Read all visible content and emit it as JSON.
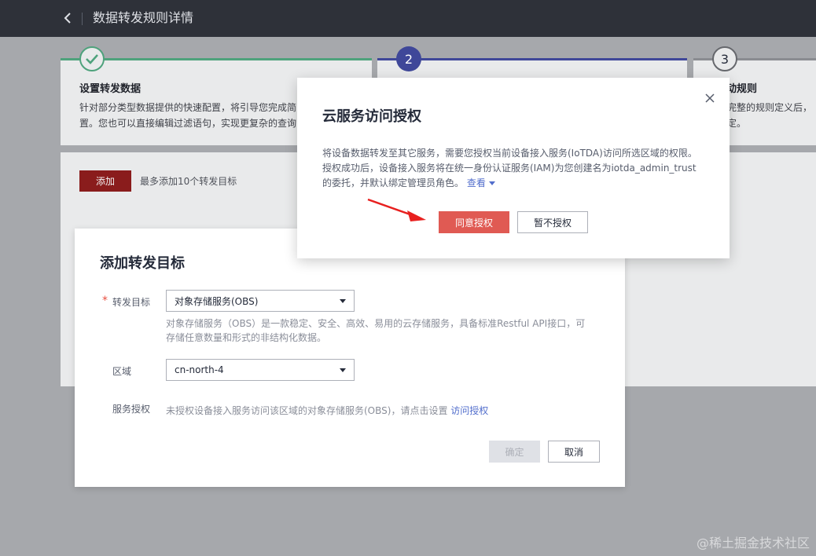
{
  "header": {
    "title": "数据转发规则详情",
    "back_icon": "chevron-left-icon"
  },
  "steps": [
    {
      "number": "",
      "state": "done",
      "title": "设置转发数据",
      "desc": "针对部分类型数据提供的快速配置，将引导您完成简置。您也可以直接编辑过滤语句，实现更复杂的查询"
    },
    {
      "number": "2",
      "state": "active",
      "title": "",
      "desc": ""
    },
    {
      "number": "3",
      "state": "pending",
      "title": "动规则",
      "desc": "完整的规则定义后，定。"
    }
  ],
  "list": {
    "add_label": "添加",
    "add_hint": "最多添加10个转发目标"
  },
  "add_dialog": {
    "title": "添加转发目标",
    "target_label": "转发目标",
    "required_mark": "*",
    "target_value": "对象存储服务(OBS)",
    "target_help": "对象存储服务（OBS）是一款稳定、安全、高效、易用的云存储服务，具备标准Restful API接口，可存储任意数量和形式的非结构化数据。",
    "region_label": "区域",
    "region_value": "cn-north-4",
    "auth_label": "服务授权",
    "auth_text": "未授权设备接入服务访问该区域的对象存储服务(OBS)，请点击设置",
    "auth_link": "访问授权",
    "confirm_label": "确定",
    "cancel_label": "取消"
  },
  "auth_dialog": {
    "title": "云服务访问授权",
    "desc": "将设备数据转发至其它服务，需要您授权当前设备接入服务(IoTDA)访问所选区域的权限。授权成功后，设备接入服务将在统一身份认证服务(IAM)为您创建名为iotda_admin_trust 的委托，并默认绑定管理员角色。",
    "more_label": "查看",
    "agree_label": "同意授权",
    "decline_label": "暂不授权"
  },
  "colors": {
    "accent_red": "#e05a53",
    "step_done": "#4ea27c",
    "step_active": "#3f4799",
    "link": "#526ecc"
  },
  "watermark": "@稀土掘金技术社区"
}
